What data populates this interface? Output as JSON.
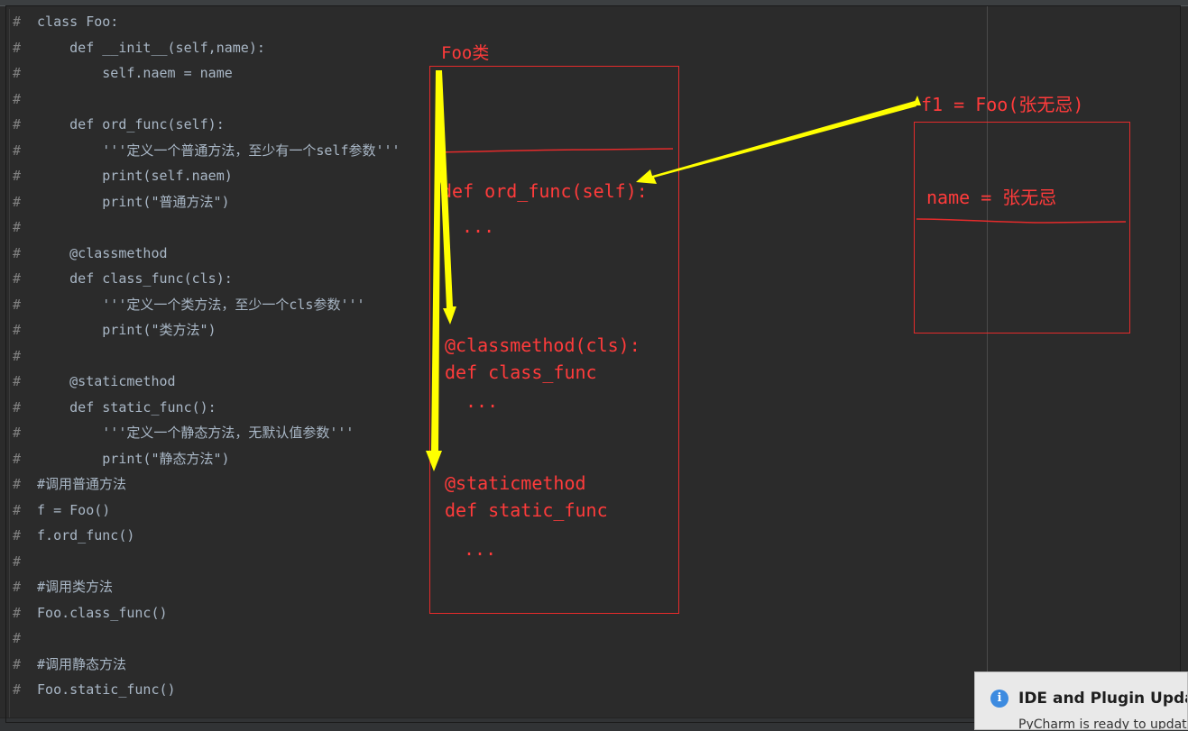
{
  "editor": {
    "lines": [
      {
        "hash": "#",
        "text": " class Foo:"
      },
      {
        "hash": "#",
        "text": "     def __init__(self,name):"
      },
      {
        "hash": "#",
        "text": "         self.naem = name"
      },
      {
        "hash": "#",
        "text": ""
      },
      {
        "hash": "#",
        "text": "     def ord_func(self):"
      },
      {
        "hash": "#",
        "text": "         '''定义一个普通方法，至少有一个self参数'''"
      },
      {
        "hash": "#",
        "text": "         print(self.naem)"
      },
      {
        "hash": "#",
        "text": "         print(\"普通方法\")"
      },
      {
        "hash": "#",
        "text": ""
      },
      {
        "hash": "#",
        "text": "     @classmethod"
      },
      {
        "hash": "#",
        "text": "     def class_func(cls):"
      },
      {
        "hash": "#",
        "text": "         '''定义一个类方法，至少一个cls参数'''"
      },
      {
        "hash": "#",
        "text": "         print(\"类方法\")"
      },
      {
        "hash": "#",
        "text": ""
      },
      {
        "hash": "#",
        "text": "     @staticmethod"
      },
      {
        "hash": "#",
        "text": "     def static_func():"
      },
      {
        "hash": "#",
        "text": "         '''定义一个静态方法，无默认值参数'''"
      },
      {
        "hash": "#",
        "text": "         print(\"静态方法\")"
      },
      {
        "hash": "#",
        "text": " #调用普通方法"
      },
      {
        "hash": "#",
        "text": " f = Foo()"
      },
      {
        "hash": "#",
        "text": " f.ord_func()"
      },
      {
        "hash": "#",
        "text": ""
      },
      {
        "hash": "#",
        "text": " #调用类方法"
      },
      {
        "hash": "#",
        "text": " Foo.class_func()"
      },
      {
        "hash": "#",
        "text": ""
      },
      {
        "hash": "#",
        "text": " #调用静态方法"
      },
      {
        "hash": "#",
        "text": " Foo.static_func()"
      }
    ]
  },
  "annotations": {
    "class_label": "Foo类",
    "instance_label": "f1 = Foo(张无忌)",
    "ord_func": "def ord_func(self):",
    "ord_dots": "...",
    "classmethod": "@classmethod(cls):",
    "class_func": "def class_func",
    "class_dots": "...",
    "staticmethod": "@staticmethod",
    "static_func": "def static_func",
    "static_dots": "...",
    "instance_attr": "name = 张无忌",
    "annotation_color": "#ff3b3b",
    "arrow_color": "#ffff00"
  },
  "notification": {
    "icon": "info-icon",
    "title": "IDE and Plugin Updates",
    "body": "PyCharm is ready to update."
  }
}
